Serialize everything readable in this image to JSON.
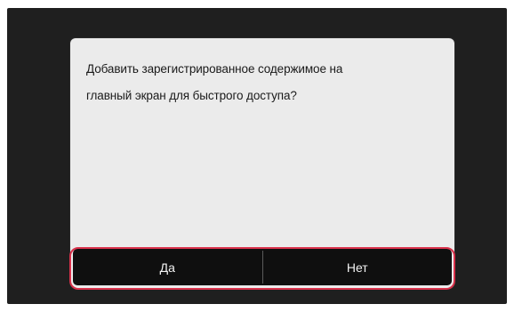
{
  "dialog": {
    "message_lines": [
      "Добавить зарегистрированное содержимое на",
      "главный экран для быстрого доступа?"
    ],
    "buttons": {
      "yes_label": "Да",
      "no_label": "Нет"
    }
  },
  "colors": {
    "bezel": "#1f1f1f",
    "dialog_background": "#ebebeb",
    "button_bar": "#0f0f0f",
    "button_text": "#f2f2f2",
    "highlight": "#d9304a"
  }
}
